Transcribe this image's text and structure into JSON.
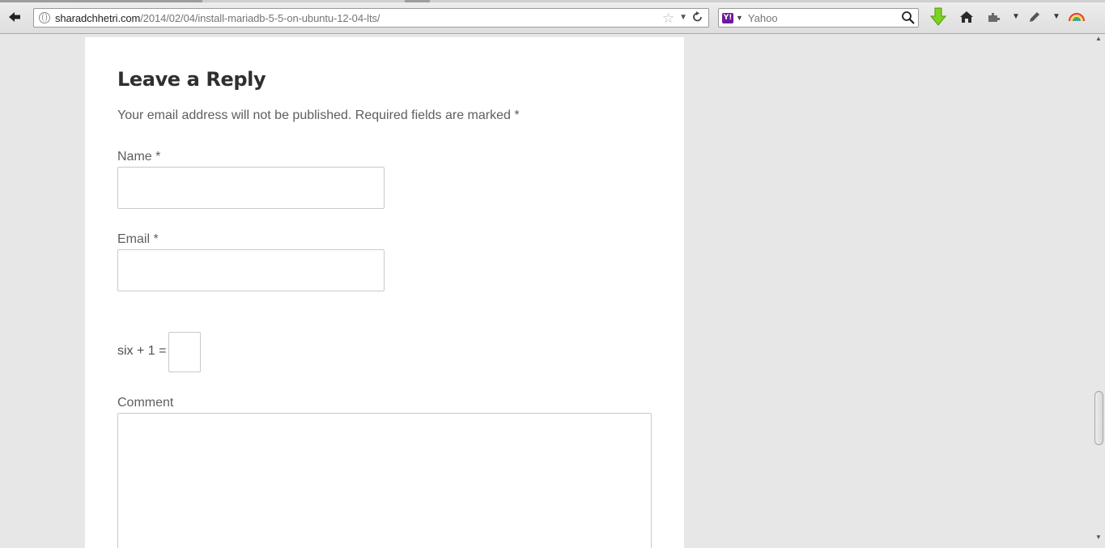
{
  "browser": {
    "url_host": "sharadchhetri.com",
    "url_path": "/2014/02/04/install-mariadb-5-5-on-ubuntu-12-04-lts/",
    "search_engine": "Yahoo",
    "search_placeholder": "Yahoo",
    "icons": {
      "back": "back-arrow-icon",
      "bookmark": "star-icon",
      "reload": "reload-icon",
      "download": "download-icon",
      "home": "home-icon",
      "addon1": "puzzle-icon",
      "addon2": "pen-icon",
      "addon3": "rainbow-icon"
    }
  },
  "reply": {
    "title": "Leave a Reply",
    "notes_text": "Your email address will not be published. Required fields are marked",
    "required_marker": "*",
    "name_label": "Name",
    "email_label": "Email",
    "captcha_question": "six + 1 =",
    "comment_label": "Comment",
    "name_value": "",
    "email_value": "",
    "captcha_value": "",
    "comment_value": ""
  },
  "colors": {
    "page_background": "#e7e7e7",
    "card_background": "#ffffff",
    "download_green": "#6ec21c",
    "yahoo_purple": "#6d1a9c"
  }
}
